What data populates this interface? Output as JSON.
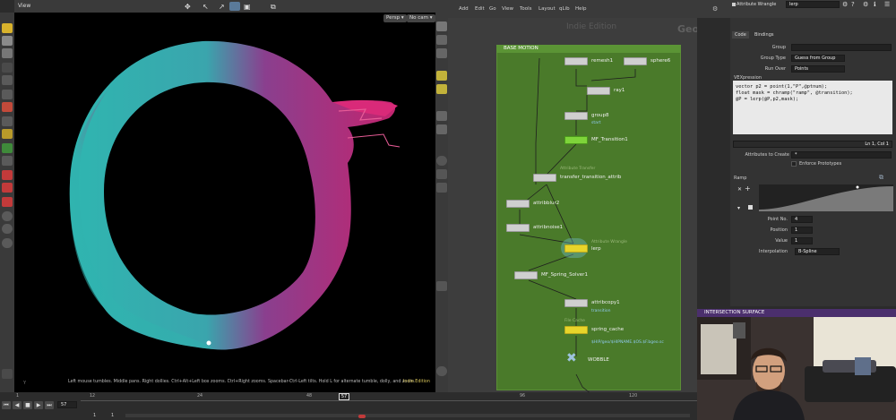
{
  "viewport": {
    "title": "View",
    "camera_persp": "Persp ▾",
    "camera_nocam": "No cam ▾",
    "status_hint": "Left mouse tumbles. Middle pans. Right dollies. Ctrl+Alt+Left box zooms. Ctrl+Right zooms. Spacebar-Ctrl-Left tilts. Hold L for alternate tumble, dolly, and zoom.",
    "edition": "Indie Edition"
  },
  "network": {
    "menu": [
      "Add",
      "Edit",
      "Go",
      "View",
      "Tools",
      "Layout",
      "qLib",
      "Help"
    ],
    "watermark_edition": "Indie Edition",
    "watermark_context": "Geometry",
    "subnet_title": "BASE MOTION",
    "nodes": [
      {
        "name": "remesh1"
      },
      {
        "name": "sphere6"
      },
      {
        "name": "ray1"
      },
      {
        "name": "group8",
        "sub": "start"
      },
      {
        "name": "MF_Transition1"
      },
      {
        "name": "transfer_transition_attrib",
        "dim": "Attribute Transfer"
      },
      {
        "name": "attribblur2"
      },
      {
        "name": "attribnoise1"
      },
      {
        "name": "lerp",
        "dim": "Attribute Wrangle"
      },
      {
        "name": "MF_Spring_Solver1"
      },
      {
        "name": "attribcopy1",
        "sub": "transition"
      },
      {
        "name": "spring_cache",
        "sub": "File Cache",
        "dim": "$HIP/geo/$HIPNAME.$OS.$F.bgeo.sc"
      },
      {
        "name": "WOBBLE"
      }
    ]
  },
  "params": {
    "node_type": "Attribute Wrangle",
    "node_name": "lerp",
    "tabs": [
      "Code",
      "Bindings"
    ],
    "group_label": "Group",
    "group_value": "",
    "group_type_label": "Group Type",
    "group_type_value": "Guess from Group",
    "run_over_label": "Run Over",
    "run_over_value": "Points",
    "vex_label": "VEXpression",
    "code": "vector p2 = point(1,\"P\",@ptnum);\nfloat mask = chramp(\"ramp\", @transition);\n@P = lerp(@P,p2,mask);",
    "line_col": "Ln 1, Col 1",
    "attrs_create_label": "Attributes to Create",
    "attrs_create_value": "*",
    "enforce_label": "Enforce Prototypes",
    "ramp_label": "Ramp",
    "point_no_label": "Point No.",
    "point_no_value": "4",
    "position_label": "Position",
    "position_value": "1",
    "value_label": "Value",
    "value_value": "1",
    "interp_label": "Interpolation",
    "interp_value": "B-Spline"
  },
  "webcam": {
    "title": "INTERSECTION SURFACE"
  },
  "timeline": {
    "ticks": [
      "1",
      "12",
      "24",
      "48",
      "57",
      "96",
      "120"
    ],
    "current_frame": "57",
    "start_frame": "1",
    "end_frame": "1",
    "frame_field": "57"
  },
  "colors": {
    "subnet": "#4a7a2a",
    "selected_node": "#e8d52a",
    "mesh_teal": "#2fb6b0",
    "mesh_magenta": "#c2256f",
    "webcam_banner": "#4b2f6d"
  }
}
